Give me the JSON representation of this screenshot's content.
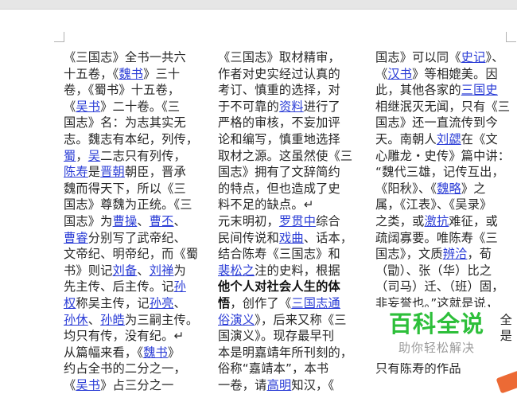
{
  "watermark": {
    "title": "百科全说",
    "subtitle": "助你轻松解决"
  },
  "columns": [
    {
      "lines": [
        [
          {
            "t": "《三国志》全书一共六"
          }
        ],
        [
          {
            "t": "十五卷，《"
          },
          {
            "t": "魏书",
            "link": true
          },
          {
            "t": "》三十"
          }
        ],
        [
          {
            "t": "卷，《蜀书》十五卷，"
          }
        ],
        [
          {
            "t": "《"
          },
          {
            "t": "吴书",
            "link": true
          },
          {
            "t": "》二十卷。《三"
          }
        ],
        [
          {
            "t": "国志》名：为志其实无"
          }
        ],
        [
          {
            "t": "志。魏志有本纪，列传，"
          }
        ],
        [
          {
            "t": "蜀",
            "link": true
          },
          {
            "t": "，"
          },
          {
            "t": "吴",
            "link": true
          },
          {
            "t": "二志只有列传，"
          }
        ],
        [
          {
            "t": "陈寿",
            "link": true
          },
          {
            "t": "是"
          },
          {
            "t": "晋朝",
            "link": true
          },
          {
            "t": "朝臣，晋承"
          }
        ],
        [
          {
            "t": "魏而得天下，所以《三"
          }
        ],
        [
          {
            "t": "国志》尊魏为正统。《三"
          }
        ],
        [
          {
            "t": "国志》为"
          },
          {
            "t": "曹操",
            "link": true
          },
          {
            "t": "、"
          },
          {
            "t": "曹丕",
            "link": true
          },
          {
            "t": "、"
          }
        ],
        [
          {
            "t": "曹睿",
            "link": true
          },
          {
            "t": "分别写了武帝纪、"
          }
        ],
        [
          {
            "t": "文帝纪、明帝纪，而《蜀"
          }
        ],
        [
          {
            "t": "书》则记"
          },
          {
            "t": "刘备",
            "link": true
          },
          {
            "t": "、"
          },
          {
            "t": "刘禅",
            "link": true
          },
          {
            "t": "为"
          }
        ],
        [
          {
            "t": "先主传、后主传。记"
          },
          {
            "t": "孙",
            "link": true
          }
        ],
        [
          {
            "t": "权",
            "link": true
          },
          {
            "t": "称吴主传，记"
          },
          {
            "t": "孙亮",
            "link": true
          },
          {
            "t": "、"
          }
        ],
        [
          {
            "t": "孙休",
            "link": true
          },
          {
            "t": "、"
          },
          {
            "t": "孙皓",
            "link": true
          },
          {
            "t": "为三嗣主传。"
          }
        ],
        [
          {
            "t": "均只有传，没有纪。↵"
          }
        ],
        [
          {
            "t": "从篇幅来看，《"
          },
          {
            "t": "魏书",
            "link": true
          },
          {
            "t": "》"
          }
        ],
        [
          {
            "t": "约占全书的二分之一，"
          }
        ],
        [
          {
            "t": "《"
          },
          {
            "t": "吴书",
            "link": true
          },
          {
            "t": "》占三分之一"
          }
        ]
      ]
    },
    {
      "lines": [
        [
          {
            "t": "《三国志》取材精审，"
          }
        ],
        [
          {
            "t": "作者对史实经过认真的"
          }
        ],
        [
          {
            "t": "考订、慎重的选择，对"
          }
        ],
        [
          {
            "t": "于不可靠的"
          },
          {
            "t": "资料",
            "link": true
          },
          {
            "t": "进行了"
          }
        ],
        [
          {
            "t": "严格的审核，不妄加评"
          }
        ],
        [
          {
            "t": "论和编写，慎重地选择"
          }
        ],
        [
          {
            "t": "取材之源。这虽然使《三"
          }
        ],
        [
          {
            "t": "国志》拥有了文辞简约"
          }
        ],
        [
          {
            "t": "的特点，但也造成了史"
          }
        ],
        [
          {
            "t": "料不足的缺点。↵"
          }
        ],
        [
          {
            "t": "元末明初，"
          },
          {
            "t": "罗贯中",
            "link": true
          },
          {
            "t": "综合"
          }
        ],
        [
          {
            "t": "民间传说和"
          },
          {
            "t": "戏曲",
            "link": true
          },
          {
            "t": "、话本，"
          }
        ],
        [
          {
            "t": "结合陈寿《三国志》和"
          }
        ],
        [
          {
            "t": "裴松之",
            "link": true
          },
          {
            "t": "注的史料，根据"
          }
        ],
        [
          {
            "t": "他个人对社会人生的体",
            "bold": true
          }
        ],
        [
          {
            "t": "悟",
            "bold": true
          },
          {
            "t": "，创作了《"
          },
          {
            "t": "三国志通",
            "link": true
          }
        ],
        [
          {
            "t": "俗演义",
            "link": true
          },
          {
            "t": "》，后来又称《三"
          }
        ],
        [
          {
            "t": "国演义》。现存最早刊"
          }
        ],
        [
          {
            "t": "本是明嘉靖年所刊刻的，"
          }
        ],
        [
          {
            "t": "俗称“嘉靖本”，本书"
          }
        ],
        [
          {
            "t": "一卷，请"
          },
          {
            "t": "高明",
            "link": true
          },
          {
            "t": "知汉，《"
          }
        ]
      ]
    },
    {
      "lines": [
        [
          {
            "t": "国志》可以同《"
          },
          {
            "t": "史记",
            "link": true
          },
          {
            "t": "》、"
          }
        ],
        [
          {
            "t": "《"
          },
          {
            "t": "汉书",
            "link": true
          },
          {
            "t": "》等相媲美。因"
          }
        ],
        [
          {
            "t": "此，其他各家的"
          },
          {
            "t": "三国史",
            "link": true
          }
        ],
        [
          {
            "t": "相继泯灭无闻，只有《三"
          }
        ],
        [
          {
            "t": "国志》还一直流传到今"
          }
        ],
        [
          {
            "t": "天。南朝人"
          },
          {
            "t": "刘勰",
            "link": true
          },
          {
            "t": "在《文"
          }
        ],
        [
          {
            "t": "心雕龙・史传》篇中讲："
          }
        ],
        [
          {
            "t": "“魏代三雄，记传互出，"
          }
        ],
        [
          {
            "t": "《阳秋》、《"
          },
          {
            "t": "魏略",
            "link": true
          },
          {
            "t": "》之"
          }
        ],
        [
          {
            "t": "属，《江表》、《吴录》"
          }
        ],
        [
          {
            "t": "之类，或"
          },
          {
            "t": "激抗",
            "link": true
          },
          {
            "t": "难征，或"
          }
        ],
        [
          {
            "t": "疏阔寡要。唯陈寿《三"
          }
        ],
        [
          {
            "t": "国志》，文质"
          },
          {
            "t": "辨洽",
            "link": true
          },
          {
            "t": "，荀"
          }
        ],
        [
          {
            "t": "（勖）、张（华）比之"
          }
        ],
        [
          {
            "t": "（司马）迁、（班）固，"
          }
        ],
        [
          {
            "t": "非妄誉也。”这就是说，"
          }
        ],
        [
          {
            "t": "全",
            "right": true
          }
        ],
        [
          {
            "t": "是",
            "right": true
          }
        ],
        [
          {
            "t": ""
          }
        ],
        [
          {
            "t": "只有陈寿的作品"
          }
        ]
      ]
    }
  ]
}
